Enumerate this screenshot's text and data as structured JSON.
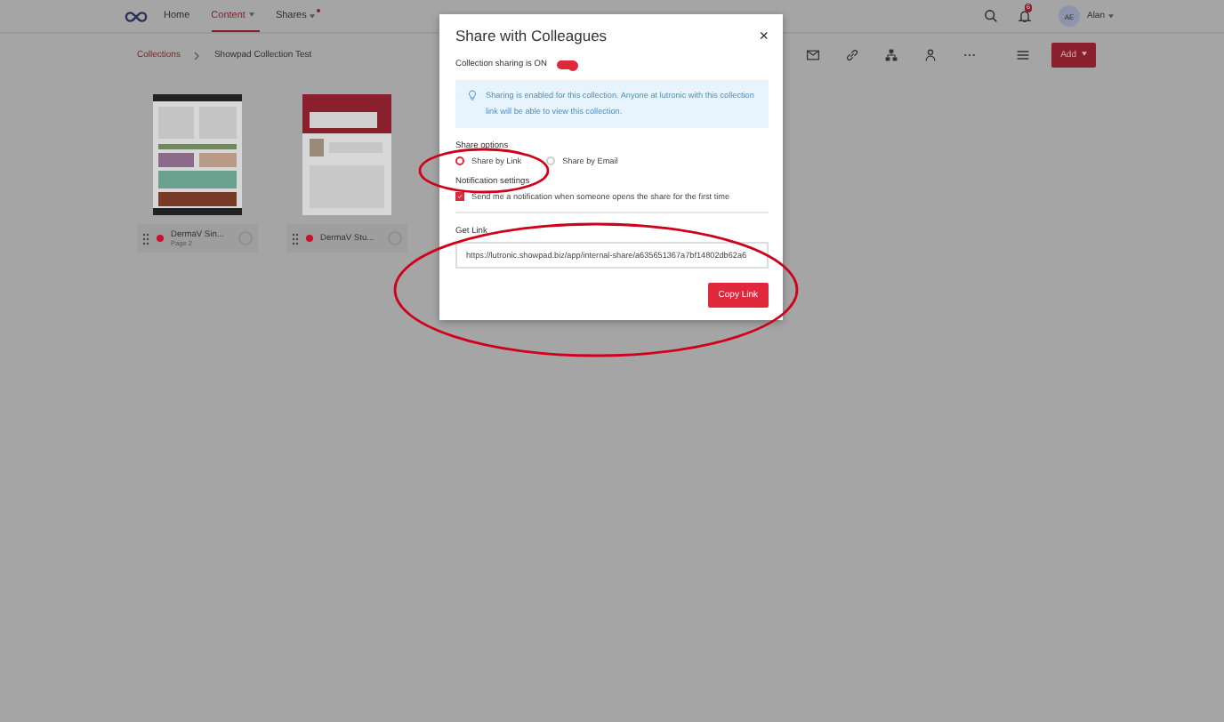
{
  "nav": {
    "items": [
      {
        "label": "Home",
        "selected": false
      },
      {
        "label": "Content",
        "selected": true,
        "caret": true,
        "dot": false
      },
      {
        "label": "Shares",
        "selected": false,
        "caret": true,
        "dot": true
      }
    ],
    "notification_count": "6",
    "avatar": "AE",
    "user": "Alan"
  },
  "breadcrumb": [
    "Collections",
    "Showpad Collection Test"
  ],
  "toolbar": {
    "add_button": "Add"
  },
  "cards": [
    {
      "title": "DermaV Sin...",
      "subtitle": "Page 2",
      "color": "#c8102e",
      "checked": false
    },
    {
      "title": "DermaV Stu...",
      "color": "#c8102e",
      "checked": false
    }
  ],
  "modal": {
    "title": "Share with Colleagues",
    "close": "×",
    "sharing_label": "Collection sharing is ON",
    "sharing_on": true,
    "info": "Sharing is enabled for this collection. Anyone at lutronic with this collection link will be able to view this collection.",
    "share_options_label": "Share options",
    "options": [
      {
        "label": "Share by Link",
        "selected": true
      },
      {
        "label": "Share by Email",
        "selected": false
      }
    ],
    "notification_label": "Notification settings",
    "notify": {
      "label": "Send me a notification when someone opens the share for the first time",
      "checked": true
    },
    "link_label": "Get Link",
    "link": "https://lutronic.showpad.biz/app/internal-share/a635651367a7bf14802db62a6",
    "copy_button": "Copy Link"
  }
}
